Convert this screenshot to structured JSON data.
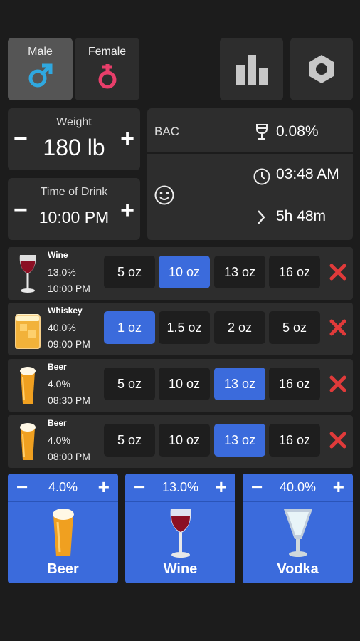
{
  "gender": {
    "male_label": "Male",
    "female_label": "Female",
    "selected": "Male"
  },
  "weight": {
    "label": "Weight",
    "value": "180 lb",
    "minus": "−",
    "plus": "+"
  },
  "time_of_drink": {
    "label": "Time of Drink",
    "value": "10:00 PM",
    "minus": "−",
    "plus": "+"
  },
  "bac": {
    "label": "BAC",
    "value": "0.08%",
    "sober_time": "03:48 AM",
    "remaining": "5h 48m"
  },
  "drinks": [
    {
      "name": "Wine",
      "abv": "13.0%",
      "time": "10:00 PM",
      "icon": "wine-glass-icon",
      "sizes": [
        "5 oz",
        "10 oz",
        "13 oz",
        "16 oz"
      ],
      "selected": 1
    },
    {
      "name": "Whiskey",
      "abv": "40.0%",
      "time": "09:00 PM",
      "icon": "whiskey-glass-icon",
      "sizes": [
        "1 oz",
        "1.5 oz",
        "2 oz",
        "5 oz"
      ],
      "selected": 0
    },
    {
      "name": "Beer",
      "abv": "4.0%",
      "time": "08:30 PM",
      "icon": "beer-glass-icon",
      "sizes": [
        "5 oz",
        "10 oz",
        "13 oz",
        "16 oz"
      ],
      "selected": 2
    },
    {
      "name": "Beer",
      "abv": "4.0%",
      "time": "08:00 PM",
      "icon": "beer-glass-icon",
      "sizes": [
        "5 oz",
        "10 oz",
        "13 oz",
        "16 oz"
      ],
      "selected": 2
    }
  ],
  "quick_add": [
    {
      "name": "Beer",
      "abv": "4.0%",
      "minus": "−",
      "plus": "+",
      "icon": "beer-glass-icon"
    },
    {
      "name": "Wine",
      "abv": "13.0%",
      "minus": "−",
      "plus": "+",
      "icon": "wine-glass-icon"
    },
    {
      "name": "Vodka",
      "abv": "40.0%",
      "minus": "−",
      "plus": "+",
      "icon": "vodka-glass-icon"
    }
  ],
  "colors": {
    "accent": "#3b6bdc",
    "male": "#2fa8e0",
    "female": "#e83e6a",
    "delete": "#e03a3a",
    "panel": "#2d2d2d",
    "background": "#1c1c1c"
  }
}
